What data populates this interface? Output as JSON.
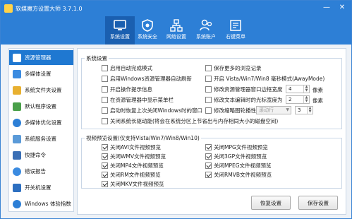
{
  "window": {
    "title": "软媒魔方设置大师 3.7.1.0",
    "minimize": "—",
    "close": "✕"
  },
  "tabs": [
    {
      "label": "系统设置",
      "icon": "system-settings-icon",
      "active": true
    },
    {
      "label": "系统安全",
      "icon": "shield-icon",
      "active": false
    },
    {
      "label": "网络设置",
      "icon": "network-icon",
      "active": false
    },
    {
      "label": "系统账户",
      "icon": "user-account-icon",
      "active": false
    },
    {
      "label": "右键菜单",
      "icon": "context-menu-icon",
      "active": false
    }
  ],
  "sidebar": {
    "items": [
      {
        "label": "资源管理器",
        "icon": "explorer-icon",
        "active": true
      },
      {
        "label": "多媒体设置",
        "icon": "media-icon",
        "active": false
      },
      {
        "label": "系统文件夹设置",
        "icon": "folder-icon",
        "active": false
      },
      {
        "label": "默认程序设置",
        "icon": "default-programs-icon",
        "active": false
      },
      {
        "label": "多媒体优化设置",
        "icon": "optimize-icon",
        "active": false
      },
      {
        "label": "系统服务设置",
        "icon": "services-icon",
        "active": false
      },
      {
        "label": "快捷命令",
        "icon": "command-icon",
        "active": false
      },
      {
        "label": "错误报告",
        "icon": "error-report-icon",
        "active": false
      },
      {
        "label": "开关机设置",
        "icon": "power-icon",
        "active": false
      },
      {
        "label": "Windows 体验指数",
        "icon": "windows-score-icon",
        "active": false
      }
    ]
  },
  "system_settings": {
    "title": "系统设置",
    "options": [
      {
        "label": "启用自动完成模式",
        "checked": false
      },
      {
        "label": "保存更多的浏览记录",
        "checked": false
      },
      {
        "label": "启用Windows资源管理器自动刷新",
        "checked": false
      },
      {
        "label": "开启 Vista/Win7/Win8 毫秒模式(AwayMode)",
        "checked": false
      },
      {
        "label": "开启操作提示信息",
        "checked": false
      },
      {
        "label": "修改资源管理器窗口边框宽度",
        "checked": false
      },
      {
        "label": "在资源管理器中显示菜单栏",
        "checked": false
      },
      {
        "label": "修改文本编辑时的光标宽度为",
        "checked": false
      },
      {
        "label": "启动时恢复上次关闭Windows时的窗口",
        "checked": false
      },
      {
        "label": "修改缩略图轮播性",
        "checked": false
      },
      {
        "label": "关闭系统长驱动能(将会在系统分区上节省出与内存相同大小的磁盘空间)",
        "checked": false
      }
    ],
    "border_width": {
      "value": "4",
      "unit": "像素"
    },
    "cursor_width": {
      "value": "2",
      "unit": "像素"
    },
    "thumb_select": {
      "value": "滚动行",
      "num": "3"
    }
  },
  "preview_settings": {
    "title": "视频预览设置(仅支持Vista/Win7/Win8/Win10)",
    "options": [
      {
        "label": "关闭AVI文件视频预览",
        "checked": true
      },
      {
        "label": "关闭MPG文件视频预览",
        "checked": true
      },
      {
        "label": "关闭WMV文件视频预览",
        "checked": true
      },
      {
        "label": "关闭3GP文件视频预览",
        "checked": true
      },
      {
        "label": "关闭MP4文件视频预览",
        "checked": true
      },
      {
        "label": "关闭MPEG文件视频预览",
        "checked": true
      },
      {
        "label": "关闭RM文件视频预览",
        "checked": true
      },
      {
        "label": "关闭RMVB文件视频预览",
        "checked": true
      },
      {
        "label": "关闭MKV文件视频预览",
        "checked": true
      }
    ]
  },
  "buttons": {
    "restore": "恢复设置",
    "save": "保存设置"
  },
  "colors": {
    "accent": "#2d7fd6",
    "active_tab": "#1a5fb0",
    "sidebar_active": "#1f78d1"
  }
}
